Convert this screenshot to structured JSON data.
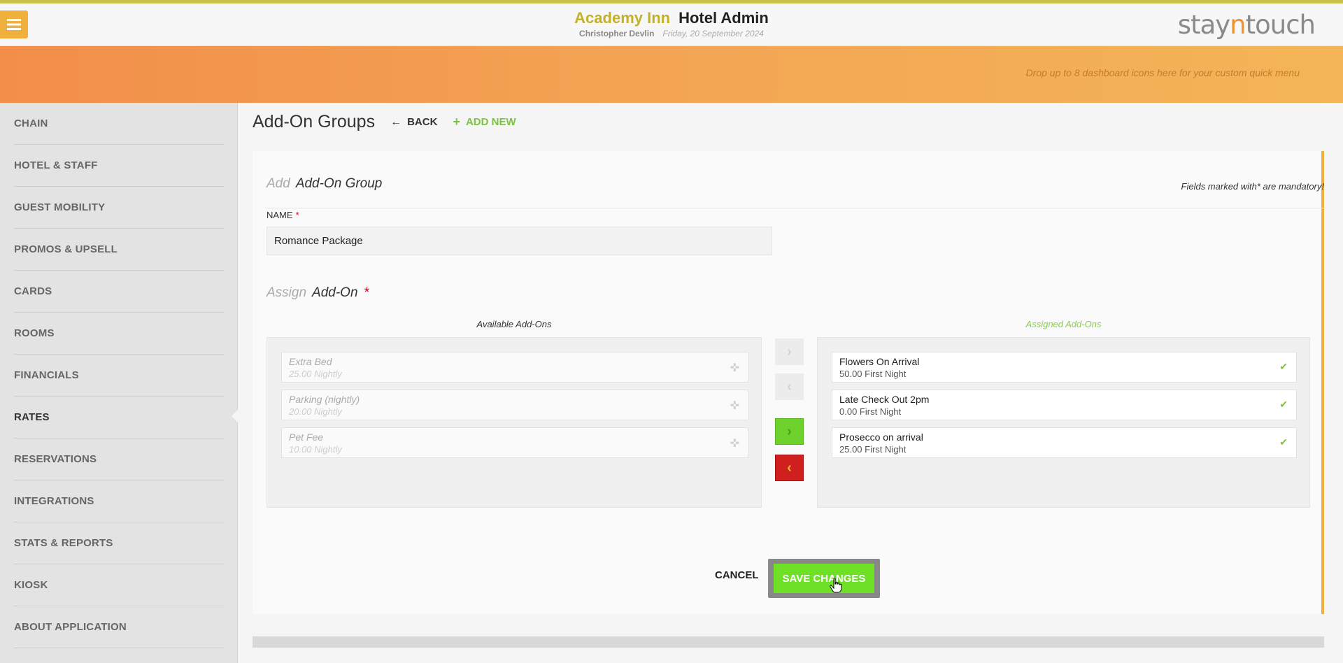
{
  "header": {
    "hotel_name": "Academy Inn",
    "app_name": "Hotel Admin",
    "user_name": "Christopher Devlin",
    "date": "Friday, 20 September 2024",
    "logo_text_a": "stay",
    "logo_text_n": "n",
    "logo_text_b": "touch",
    "menu_icon": "hamburger-icon"
  },
  "banner": {
    "hint": "Drop up to 8 dashboard icons here for your custom quick menu"
  },
  "sidebar": {
    "items": [
      {
        "label": "CHAIN"
      },
      {
        "label": "HOTEL & STAFF"
      },
      {
        "label": "GUEST MOBILITY"
      },
      {
        "label": "PROMOS & UPSELL"
      },
      {
        "label": "CARDS"
      },
      {
        "label": "ROOMS"
      },
      {
        "label": "FINANCIALS"
      },
      {
        "label": "RATES"
      },
      {
        "label": "RESERVATIONS"
      },
      {
        "label": "INTEGRATIONS"
      },
      {
        "label": "STATS & REPORTS"
      },
      {
        "label": "KIOSK"
      },
      {
        "label": "ABOUT APPLICATION"
      }
    ],
    "active": "RATES"
  },
  "page": {
    "title": "Add-On Groups",
    "back_label": "BACK",
    "add_new_label": "ADD NEW"
  },
  "form": {
    "heading_muted": "Add",
    "heading": "Add-On Group",
    "mandatory_note": "Fields marked with* are mandatory!",
    "name_label": "NAME",
    "required_mark": "*",
    "name_value": "Romance Package",
    "assign_muted": "Assign",
    "assign_heading": "Add-On",
    "available_label": "Available Add-Ons",
    "assigned_label": "Assigned Add-Ons",
    "available": [
      {
        "name": "Extra Bed",
        "detail": "25.00 Nightly"
      },
      {
        "name": "Parking (nightly)",
        "detail": "20.00 Nightly"
      },
      {
        "name": "Pet Fee",
        "detail": "10.00 Nightly"
      }
    ],
    "assigned": [
      {
        "name": "Flowers On Arrival",
        "detail": "50.00 First Night"
      },
      {
        "name": "Late Check Out 2pm",
        "detail": "0.00 First Night"
      },
      {
        "name": "Prosecco on arrival",
        "detail": "25.00 First Night"
      }
    ],
    "move_buttons": {
      "move_right": "›",
      "move_left": "‹",
      "move_all_right": "›",
      "move_all_left": "‹"
    },
    "cancel_label": "CANCEL",
    "save_label": "SAVE CHANGES"
  },
  "colors": {
    "accent_orange": "#f0b03c",
    "green": "#6ee126",
    "red": "#d01f1f"
  }
}
